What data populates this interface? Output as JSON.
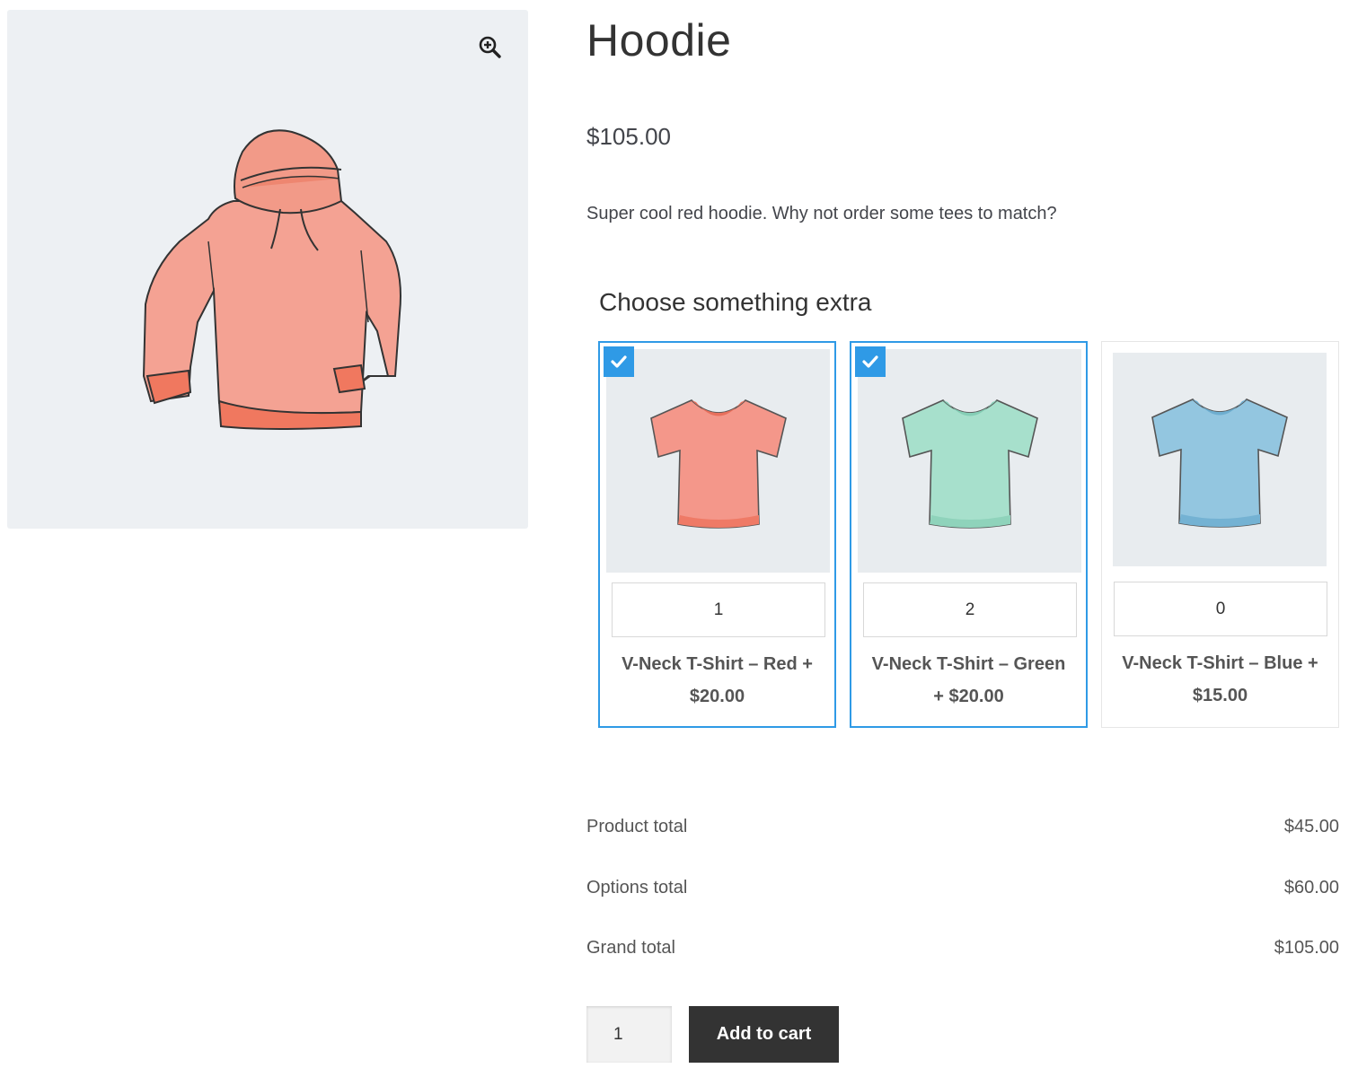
{
  "product": {
    "title": "Hoodie",
    "price": "$105.00",
    "description": "Super cool red hoodie. Why not order some tees to match?"
  },
  "extras": {
    "heading": "Choose something extra",
    "items": [
      {
        "name": "V-Neck T-Shirt – Red +",
        "price": "$20.00",
        "qty": "1",
        "selected": true,
        "color": "#f0907c"
      },
      {
        "name": "V-Neck T-Shirt – Green",
        "price": "+ $20.00",
        "qty": "2",
        "selected": true,
        "color": "#9fdcc8"
      },
      {
        "name": "V-Neck T-Shirt – Blue +",
        "price": "$15.00",
        "qty": "0",
        "selected": false,
        "color": "#8fc3de"
      }
    ]
  },
  "totals": {
    "product_label": "Product total",
    "product_value": "$45.00",
    "options_label": "Options total",
    "options_value": "$60.00",
    "grand_label": "Grand total",
    "grand_value": "$105.00"
  },
  "cart": {
    "qty": "1",
    "add_label": "Add to cart"
  },
  "colors": {
    "accent": "#2f9ae6",
    "button": "#333333",
    "hoodie": "#f3907a"
  },
  "icons": [
    "zoom-in-icon",
    "checkmark-icon"
  ]
}
